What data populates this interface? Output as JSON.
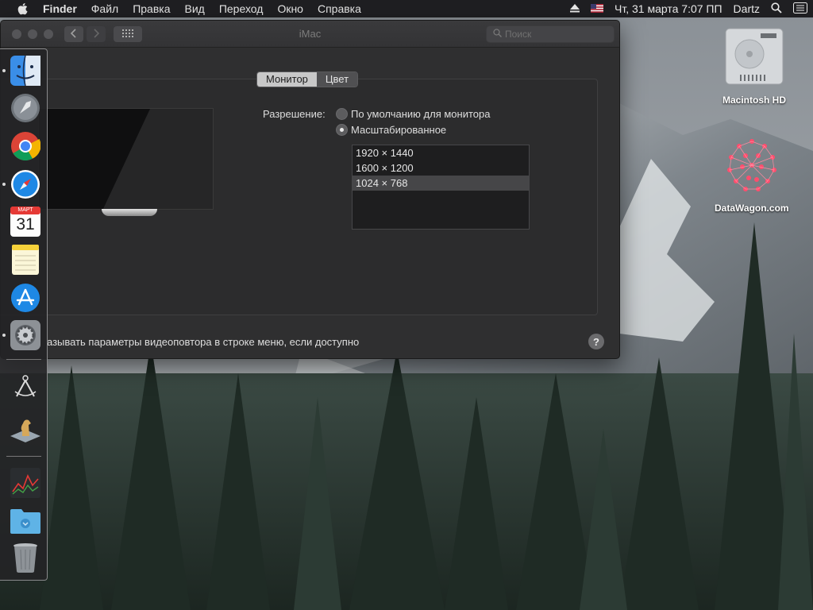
{
  "menubar": {
    "app_name": "Finder",
    "items": [
      "Файл",
      "Правка",
      "Вид",
      "Переход",
      "Окно",
      "Справка"
    ],
    "clock": "Чт, 31 марта  7:07 ПП",
    "user": "Dartz",
    "icons": [
      "apple-icon",
      "eject-icon",
      "us-flag-icon",
      "search-icon",
      "list-icon"
    ]
  },
  "window": {
    "title": "iMac",
    "search_placeholder": "Поиск",
    "tabs": [
      {
        "label": "Монитор",
        "active": false
      },
      {
        "label": "Цвет",
        "active": true
      }
    ],
    "resolution_label": "Разрешение:",
    "radio_default": "По умолчанию для монитора",
    "radio_scaled": "Масштабированное",
    "resolutions": [
      "1920 × 1440",
      "1600 × 1200",
      "1024 × 768"
    ],
    "selected_resolution": "1024 × 768",
    "mirror_option": "азывать параметры видеоповтора в строке меню, если доступно",
    "help": "?"
  },
  "dock": {
    "apps": [
      "Finder",
      "Launchpad",
      "Google Chrome",
      "Safari",
      "Календарь",
      "Заметки",
      "App Store",
      "Системные настройки",
      "Утилита",
      "Шахматы",
      "Монитор",
      "Загрузки",
      "Корзина"
    ],
    "calendar_month": "МАРТ",
    "calendar_day": "31"
  },
  "desktop": {
    "icons": [
      {
        "label": "Macintosh HD"
      },
      {
        "label": "DataWagon.com"
      }
    ]
  }
}
